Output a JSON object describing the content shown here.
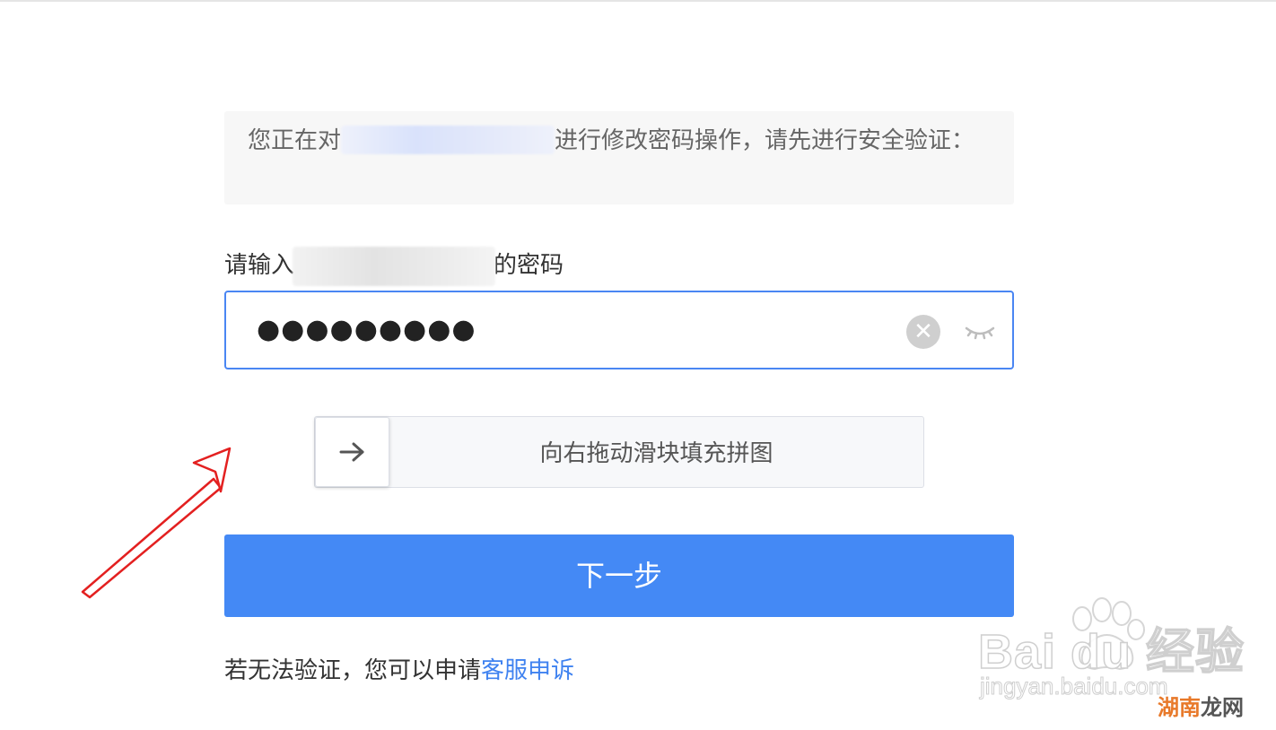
{
  "notice": {
    "text_before": "您正在对",
    "text_after": "进行修改密码操作，请先进行安全验证："
  },
  "password_label": {
    "prefix": "请输入",
    "suffix": "的密码"
  },
  "password_input": {
    "value": "●●●●●●●●●",
    "clear_icon": "close-circle-icon",
    "toggle_icon": "eye-closed-icon"
  },
  "slider": {
    "text": "向右拖动滑块填充拼图",
    "handle_icon": "arrow-right-icon"
  },
  "next_button": {
    "label": "下一步",
    "color": "#4489f5"
  },
  "footer": {
    "text": "若无法验证，您可以申请",
    "link": "客服申诉",
    "link_color": "#3f82f0"
  },
  "watermarks": {
    "baidu_logo": "Bai du 经验",
    "baidu_url": "jingyan.baidu.com",
    "site_part1": "湖南",
    "site_part2": "龙网"
  },
  "accent_color": "#4a86f3"
}
